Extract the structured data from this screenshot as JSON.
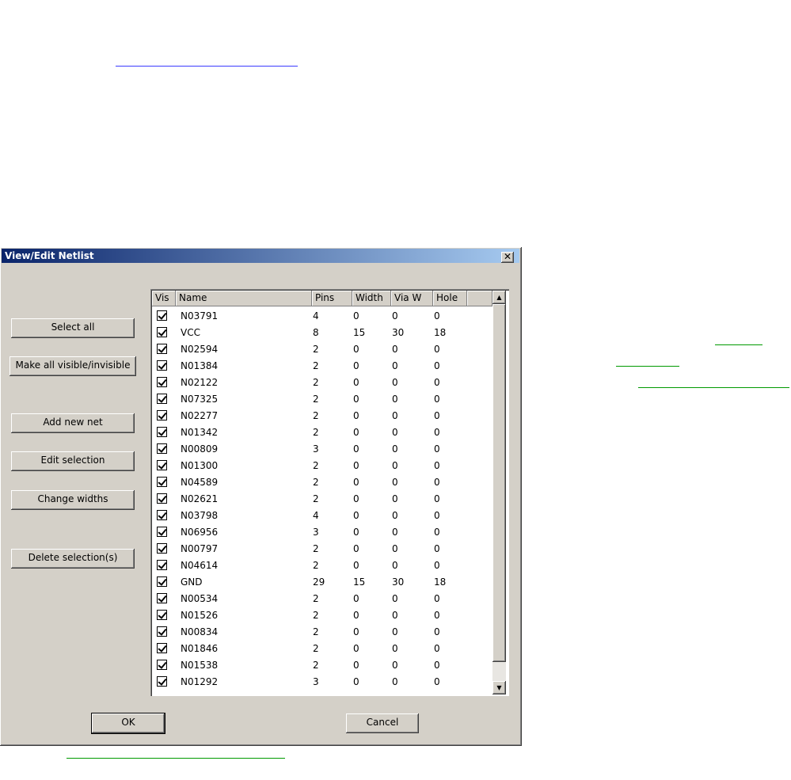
{
  "dialog": {
    "title": "View/Edit Netlist",
    "close_label": "✕",
    "buttons": {
      "select_all": "Select all",
      "make_visible": "Make all visible/invisible",
      "add_new_net": "Add new net",
      "edit_selection": "Edit selection",
      "change_widths": "Change widths",
      "delete_selections": "Delete selection(s)",
      "ok": "OK",
      "cancel": "Cancel"
    },
    "table": {
      "columns": [
        "Vis",
        "Name",
        "Pins",
        "Width",
        "Via W",
        "Hole"
      ],
      "rows": [
        {
          "vis": true,
          "name": "N03791",
          "pins": "4",
          "width": "0",
          "via_w": "0",
          "hole": "0"
        },
        {
          "vis": true,
          "name": "VCC",
          "pins": "8",
          "width": "15",
          "via_w": "30",
          "hole": "18"
        },
        {
          "vis": true,
          "name": "N02594",
          "pins": "2",
          "width": "0",
          "via_w": "0",
          "hole": "0"
        },
        {
          "vis": true,
          "name": "N01384",
          "pins": "2",
          "width": "0",
          "via_w": "0",
          "hole": "0"
        },
        {
          "vis": true,
          "name": "N02122",
          "pins": "2",
          "width": "0",
          "via_w": "0",
          "hole": "0"
        },
        {
          "vis": true,
          "name": "N07325",
          "pins": "2",
          "width": "0",
          "via_w": "0",
          "hole": "0"
        },
        {
          "vis": true,
          "name": "N02277",
          "pins": "2",
          "width": "0",
          "via_w": "0",
          "hole": "0"
        },
        {
          "vis": true,
          "name": "N01342",
          "pins": "2",
          "width": "0",
          "via_w": "0",
          "hole": "0"
        },
        {
          "vis": true,
          "name": "N00809",
          "pins": "3",
          "width": "0",
          "via_w": "0",
          "hole": "0"
        },
        {
          "vis": true,
          "name": "N01300",
          "pins": "2",
          "width": "0",
          "via_w": "0",
          "hole": "0"
        },
        {
          "vis": true,
          "name": "N04589",
          "pins": "2",
          "width": "0",
          "via_w": "0",
          "hole": "0"
        },
        {
          "vis": true,
          "name": "N02621",
          "pins": "2",
          "width": "0",
          "via_w": "0",
          "hole": "0"
        },
        {
          "vis": true,
          "name": "N03798",
          "pins": "4",
          "width": "0",
          "via_w": "0",
          "hole": "0"
        },
        {
          "vis": true,
          "name": "N06956",
          "pins": "3",
          "width": "0",
          "via_w": "0",
          "hole": "0"
        },
        {
          "vis": true,
          "name": "N00797",
          "pins": "2",
          "width": "0",
          "via_w": "0",
          "hole": "0"
        },
        {
          "vis": true,
          "name": "N04614",
          "pins": "2",
          "width": "0",
          "via_w": "0",
          "hole": "0"
        },
        {
          "vis": true,
          "name": "GND",
          "pins": "29",
          "width": "15",
          "via_w": "30",
          "hole": "18"
        },
        {
          "vis": true,
          "name": "N00534",
          "pins": "2",
          "width": "0",
          "via_w": "0",
          "hole": "0"
        },
        {
          "vis": true,
          "name": "N01526",
          "pins": "2",
          "width": "0",
          "via_w": "0",
          "hole": "0"
        },
        {
          "vis": true,
          "name": "N00834",
          "pins": "2",
          "width": "0",
          "via_w": "0",
          "hole": "0"
        },
        {
          "vis": true,
          "name": "N01846",
          "pins": "2",
          "width": "0",
          "via_w": "0",
          "hole": "0"
        },
        {
          "vis": true,
          "name": "N01538",
          "pins": "2",
          "width": "0",
          "via_w": "0",
          "hole": "0"
        },
        {
          "vis": true,
          "name": "N01292",
          "pins": "3",
          "width": "0",
          "via_w": "0",
          "hole": "0"
        }
      ]
    },
    "scroll_up_icon": "▲",
    "scroll_down_icon": "▼"
  },
  "colors": {
    "title_gradient_start": "#0a246a",
    "title_gradient_end": "#a6caf0",
    "dialog_face": "#d4d0c8",
    "link_blue": "#1a1aff",
    "link_green": "#009900"
  }
}
